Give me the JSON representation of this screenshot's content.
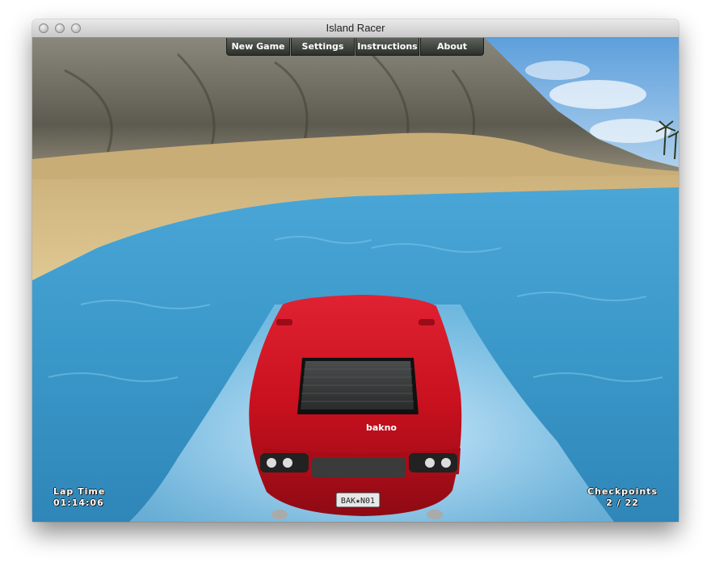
{
  "window": {
    "title": "Island Racer"
  },
  "menu": {
    "items": [
      {
        "label": "New Game"
      },
      {
        "label": "Settings"
      },
      {
        "label": "Instructions"
      },
      {
        "label": "About"
      }
    ]
  },
  "hud": {
    "lap_time_label": "Lap Time",
    "lap_time_value": "01:14:06",
    "checkpoints_label": "Checkpoints",
    "checkpoints_value": "2 / 22"
  },
  "car": {
    "color": "#c8101e",
    "badge": "bakno",
    "license_plate": "BAK★N01"
  },
  "colors": {
    "water": "#3a98c9",
    "sand": "#d9c08e",
    "sky": "#7fb6e6",
    "menu_button": "#3c403a"
  }
}
